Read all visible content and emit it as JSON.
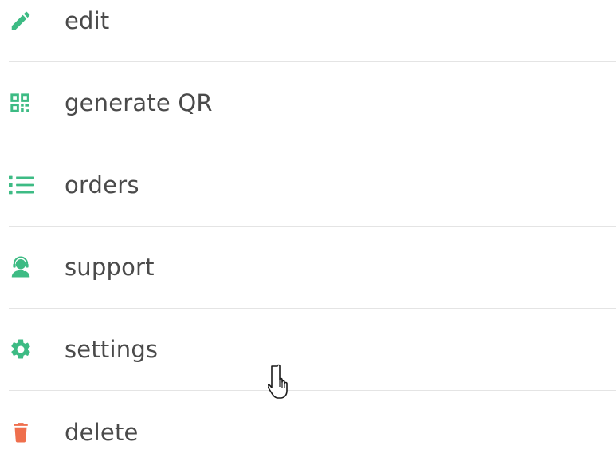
{
  "menu": {
    "items": [
      {
        "label": "edit",
        "icon": "pencil-icon",
        "color": "#3dbb84"
      },
      {
        "label": "generate QR",
        "icon": "qr-code-icon",
        "color": "#3dbb84"
      },
      {
        "label": "orders",
        "icon": "list-icon",
        "color": "#3dbb84"
      },
      {
        "label": "support",
        "icon": "headset-agent-icon",
        "color": "#3dbb84"
      },
      {
        "label": "settings",
        "icon": "gear-icon",
        "color": "#3dbb84"
      },
      {
        "label": "delete",
        "icon": "trash-icon",
        "color": "#ef6f4d"
      }
    ]
  },
  "colors": {
    "accent": "#3dbb84",
    "danger": "#ef6f4d",
    "text": "#4a4a4a",
    "divider": "#e4e4e4"
  }
}
